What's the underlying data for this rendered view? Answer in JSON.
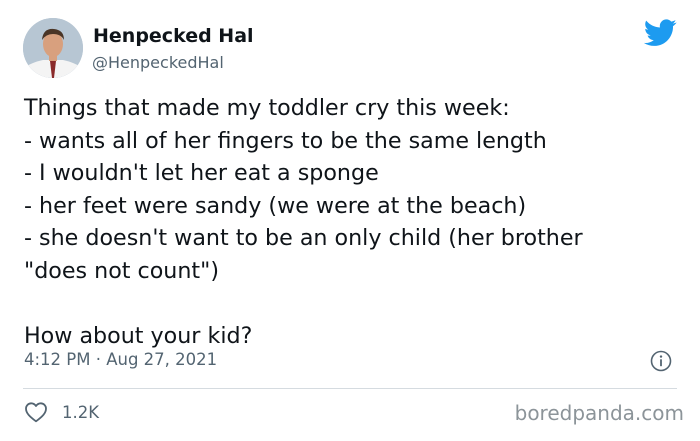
{
  "author": {
    "name": "Henpecked Hal",
    "handle": "@HenpeckedHal"
  },
  "icons": {
    "platform": "twitter-bird-icon",
    "info": "info-icon",
    "like": "heart-icon",
    "brand_color": "#1d9bf0"
  },
  "tweet": {
    "lines": [
      "Things that made my toddler cry this week:",
      "- wants all of her fingers to be the same length",
      "- I wouldn't let her eat a sponge",
      "- her feet were sandy (we were at the beach)",
      "- she doesn't want to be an only child (her brother",
      "\"does not count\")",
      "",
      "How about your kid?"
    ],
    "timestamp": "4:12 PM · Aug 27, 2021",
    "likes": "1.2K"
  },
  "watermark": "boredpanda.com"
}
